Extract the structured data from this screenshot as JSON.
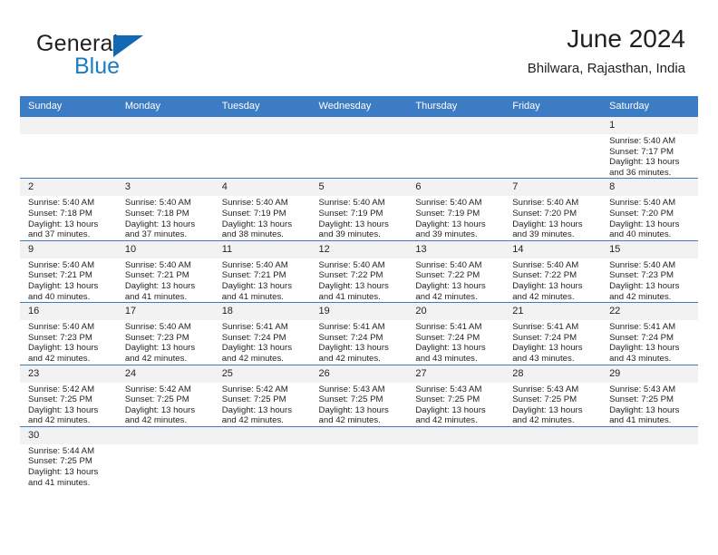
{
  "brand": {
    "word1": "General",
    "word2": "Blue",
    "accent_color": "#1268b3"
  },
  "header": {
    "title": "June 2024",
    "subtitle": "Bhilwara, Rajasthan, India"
  },
  "theme": {
    "header_blue": "#3b7cc4",
    "daynum_gray": "#f2f2f2",
    "text": "#231f20"
  },
  "weekdays": [
    "Sunday",
    "Monday",
    "Tuesday",
    "Wednesday",
    "Thursday",
    "Friday",
    "Saturday"
  ],
  "weeks": [
    [
      {
        "day": "",
        "sunrise": "",
        "sunset": "",
        "daylight_line1": "",
        "daylight_line2": "",
        "blank": true
      },
      {
        "day": "",
        "sunrise": "",
        "sunset": "",
        "daylight_line1": "",
        "daylight_line2": "",
        "blank": true
      },
      {
        "day": "",
        "sunrise": "",
        "sunset": "",
        "daylight_line1": "",
        "daylight_line2": "",
        "blank": true
      },
      {
        "day": "",
        "sunrise": "",
        "sunset": "",
        "daylight_line1": "",
        "daylight_line2": "",
        "blank": true
      },
      {
        "day": "",
        "sunrise": "",
        "sunset": "",
        "daylight_line1": "",
        "daylight_line2": "",
        "blank": true
      },
      {
        "day": "",
        "sunrise": "",
        "sunset": "",
        "daylight_line1": "",
        "daylight_line2": "",
        "blank": true
      },
      {
        "day": "1",
        "sunrise": "Sunrise: 5:40 AM",
        "sunset": "Sunset: 7:17 PM",
        "daylight_line1": "Daylight: 13 hours",
        "daylight_line2": "and 36 minutes."
      }
    ],
    [
      {
        "day": "2",
        "sunrise": "Sunrise: 5:40 AM",
        "sunset": "Sunset: 7:18 PM",
        "daylight_line1": "Daylight: 13 hours",
        "daylight_line2": "and 37 minutes."
      },
      {
        "day": "3",
        "sunrise": "Sunrise: 5:40 AM",
        "sunset": "Sunset: 7:18 PM",
        "daylight_line1": "Daylight: 13 hours",
        "daylight_line2": "and 37 minutes."
      },
      {
        "day": "4",
        "sunrise": "Sunrise: 5:40 AM",
        "sunset": "Sunset: 7:19 PM",
        "daylight_line1": "Daylight: 13 hours",
        "daylight_line2": "and 38 minutes."
      },
      {
        "day": "5",
        "sunrise": "Sunrise: 5:40 AM",
        "sunset": "Sunset: 7:19 PM",
        "daylight_line1": "Daylight: 13 hours",
        "daylight_line2": "and 39 minutes."
      },
      {
        "day": "6",
        "sunrise": "Sunrise: 5:40 AM",
        "sunset": "Sunset: 7:19 PM",
        "daylight_line1": "Daylight: 13 hours",
        "daylight_line2": "and 39 minutes."
      },
      {
        "day": "7",
        "sunrise": "Sunrise: 5:40 AM",
        "sunset": "Sunset: 7:20 PM",
        "daylight_line1": "Daylight: 13 hours",
        "daylight_line2": "and 39 minutes."
      },
      {
        "day": "8",
        "sunrise": "Sunrise: 5:40 AM",
        "sunset": "Sunset: 7:20 PM",
        "daylight_line1": "Daylight: 13 hours",
        "daylight_line2": "and 40 minutes."
      }
    ],
    [
      {
        "day": "9",
        "sunrise": "Sunrise: 5:40 AM",
        "sunset": "Sunset: 7:21 PM",
        "daylight_line1": "Daylight: 13 hours",
        "daylight_line2": "and 40 minutes."
      },
      {
        "day": "10",
        "sunrise": "Sunrise: 5:40 AM",
        "sunset": "Sunset: 7:21 PM",
        "daylight_line1": "Daylight: 13 hours",
        "daylight_line2": "and 41 minutes."
      },
      {
        "day": "11",
        "sunrise": "Sunrise: 5:40 AM",
        "sunset": "Sunset: 7:21 PM",
        "daylight_line1": "Daylight: 13 hours",
        "daylight_line2": "and 41 minutes."
      },
      {
        "day": "12",
        "sunrise": "Sunrise: 5:40 AM",
        "sunset": "Sunset: 7:22 PM",
        "daylight_line1": "Daylight: 13 hours",
        "daylight_line2": "and 41 minutes."
      },
      {
        "day": "13",
        "sunrise": "Sunrise: 5:40 AM",
        "sunset": "Sunset: 7:22 PM",
        "daylight_line1": "Daylight: 13 hours",
        "daylight_line2": "and 42 minutes."
      },
      {
        "day": "14",
        "sunrise": "Sunrise: 5:40 AM",
        "sunset": "Sunset: 7:22 PM",
        "daylight_line1": "Daylight: 13 hours",
        "daylight_line2": "and 42 minutes."
      },
      {
        "day": "15",
        "sunrise": "Sunrise: 5:40 AM",
        "sunset": "Sunset: 7:23 PM",
        "daylight_line1": "Daylight: 13 hours",
        "daylight_line2": "and 42 minutes."
      }
    ],
    [
      {
        "day": "16",
        "sunrise": "Sunrise: 5:40 AM",
        "sunset": "Sunset: 7:23 PM",
        "daylight_line1": "Daylight: 13 hours",
        "daylight_line2": "and 42 minutes."
      },
      {
        "day": "17",
        "sunrise": "Sunrise: 5:40 AM",
        "sunset": "Sunset: 7:23 PM",
        "daylight_line1": "Daylight: 13 hours",
        "daylight_line2": "and 42 minutes."
      },
      {
        "day": "18",
        "sunrise": "Sunrise: 5:41 AM",
        "sunset": "Sunset: 7:24 PM",
        "daylight_line1": "Daylight: 13 hours",
        "daylight_line2": "and 42 minutes."
      },
      {
        "day": "19",
        "sunrise": "Sunrise: 5:41 AM",
        "sunset": "Sunset: 7:24 PM",
        "daylight_line1": "Daylight: 13 hours",
        "daylight_line2": "and 42 minutes."
      },
      {
        "day": "20",
        "sunrise": "Sunrise: 5:41 AM",
        "sunset": "Sunset: 7:24 PM",
        "daylight_line1": "Daylight: 13 hours",
        "daylight_line2": "and 43 minutes."
      },
      {
        "day": "21",
        "sunrise": "Sunrise: 5:41 AM",
        "sunset": "Sunset: 7:24 PM",
        "daylight_line1": "Daylight: 13 hours",
        "daylight_line2": "and 43 minutes."
      },
      {
        "day": "22",
        "sunrise": "Sunrise: 5:41 AM",
        "sunset": "Sunset: 7:24 PM",
        "daylight_line1": "Daylight: 13 hours",
        "daylight_line2": "and 43 minutes."
      }
    ],
    [
      {
        "day": "23",
        "sunrise": "Sunrise: 5:42 AM",
        "sunset": "Sunset: 7:25 PM",
        "daylight_line1": "Daylight: 13 hours",
        "daylight_line2": "and 42 minutes."
      },
      {
        "day": "24",
        "sunrise": "Sunrise: 5:42 AM",
        "sunset": "Sunset: 7:25 PM",
        "daylight_line1": "Daylight: 13 hours",
        "daylight_line2": "and 42 minutes."
      },
      {
        "day": "25",
        "sunrise": "Sunrise: 5:42 AM",
        "sunset": "Sunset: 7:25 PM",
        "daylight_line1": "Daylight: 13 hours",
        "daylight_line2": "and 42 minutes."
      },
      {
        "day": "26",
        "sunrise": "Sunrise: 5:43 AM",
        "sunset": "Sunset: 7:25 PM",
        "daylight_line1": "Daylight: 13 hours",
        "daylight_line2": "and 42 minutes."
      },
      {
        "day": "27",
        "sunrise": "Sunrise: 5:43 AM",
        "sunset": "Sunset: 7:25 PM",
        "daylight_line1": "Daylight: 13 hours",
        "daylight_line2": "and 42 minutes."
      },
      {
        "day": "28",
        "sunrise": "Sunrise: 5:43 AM",
        "sunset": "Sunset: 7:25 PM",
        "daylight_line1": "Daylight: 13 hours",
        "daylight_line2": "and 42 minutes."
      },
      {
        "day": "29",
        "sunrise": "Sunrise: 5:43 AM",
        "sunset": "Sunset: 7:25 PM",
        "daylight_line1": "Daylight: 13 hours",
        "daylight_line2": "and 41 minutes."
      }
    ],
    [
      {
        "day": "30",
        "sunrise": "Sunrise: 5:44 AM",
        "sunset": "Sunset: 7:25 PM",
        "daylight_line1": "Daylight: 13 hours",
        "daylight_line2": "and 41 minutes."
      },
      {
        "day": "",
        "sunrise": "",
        "sunset": "",
        "daylight_line1": "",
        "daylight_line2": "",
        "blank": true
      },
      {
        "day": "",
        "sunrise": "",
        "sunset": "",
        "daylight_line1": "",
        "daylight_line2": "",
        "blank": true
      },
      {
        "day": "",
        "sunrise": "",
        "sunset": "",
        "daylight_line1": "",
        "daylight_line2": "",
        "blank": true
      },
      {
        "day": "",
        "sunrise": "",
        "sunset": "",
        "daylight_line1": "",
        "daylight_line2": "",
        "blank": true
      },
      {
        "day": "",
        "sunrise": "",
        "sunset": "",
        "daylight_line1": "",
        "daylight_line2": "",
        "blank": true
      },
      {
        "day": "",
        "sunrise": "",
        "sunset": "",
        "daylight_line1": "",
        "daylight_line2": "",
        "blank": true
      }
    ]
  ]
}
